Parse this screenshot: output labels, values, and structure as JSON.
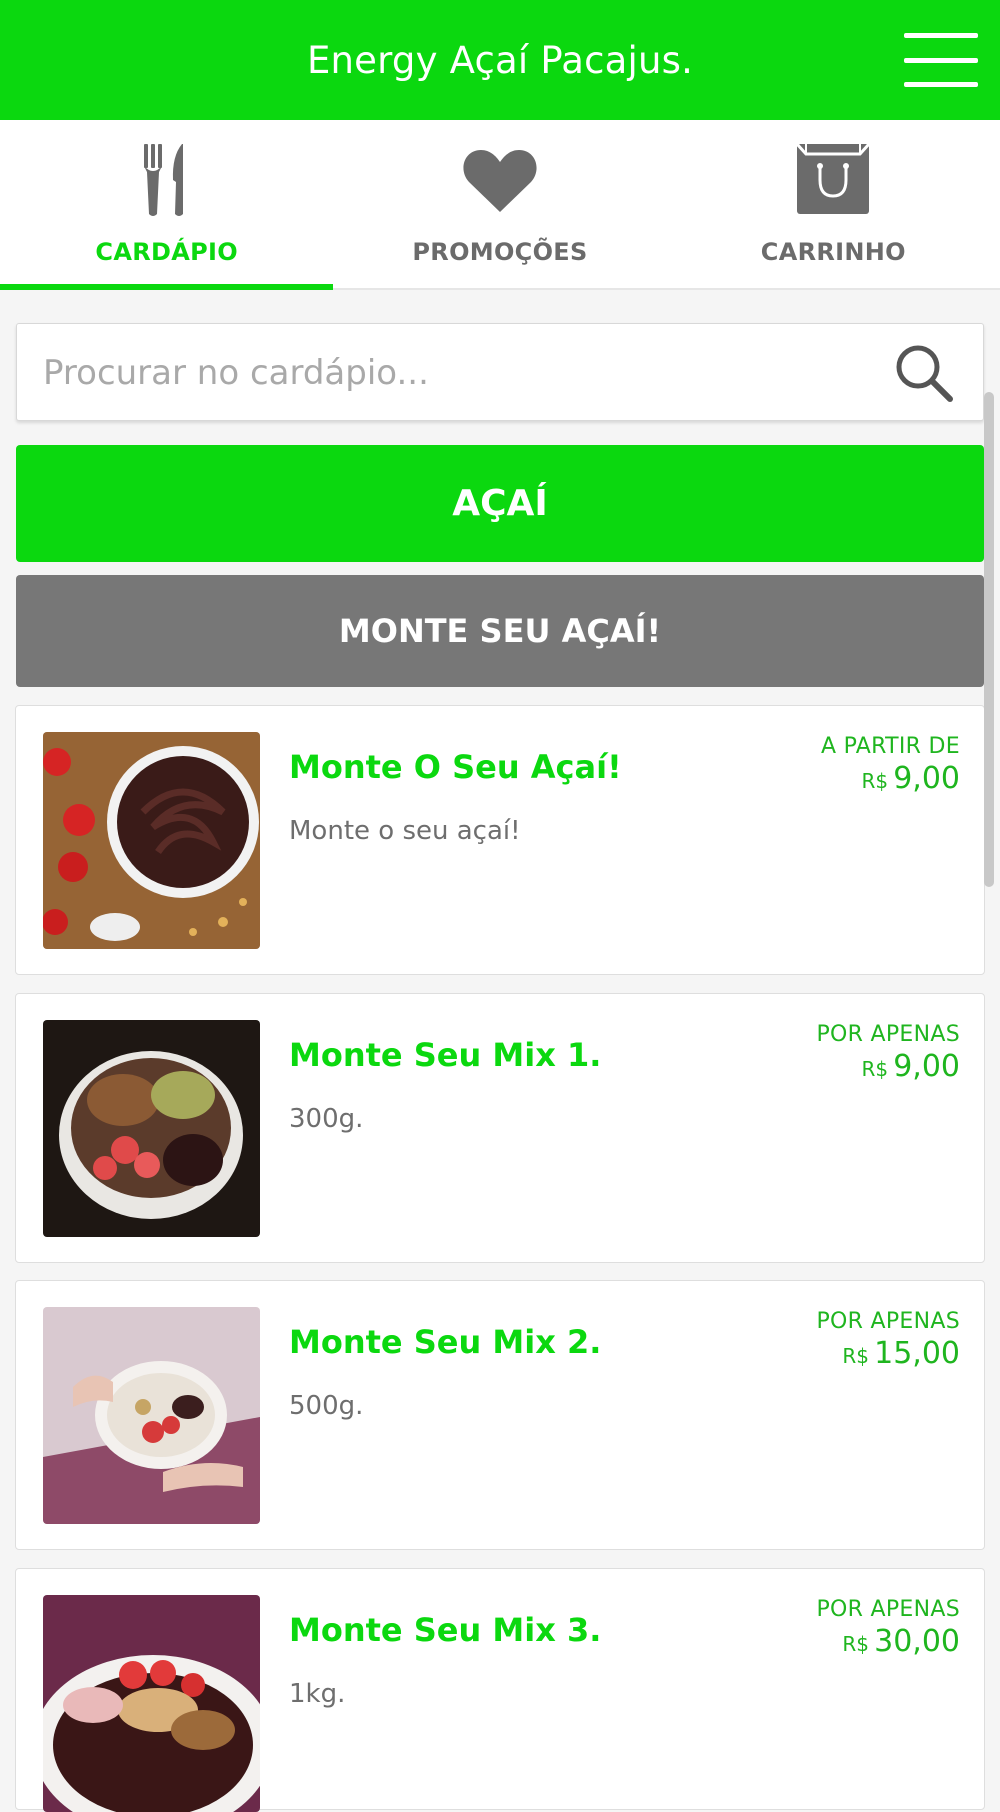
{
  "header": {
    "title": "Energy Açaí Pacajus.",
    "brand_color": "#0bd80f"
  },
  "tabs": [
    {
      "label": "CARDÁPIO",
      "icon": "fork-knife-icon",
      "active": true
    },
    {
      "label": "PROMOÇÕES",
      "icon": "heart-icon",
      "active": false
    },
    {
      "label": "CARRINHO",
      "icon": "shopping-bag-icon",
      "active": false
    }
  ],
  "search": {
    "placeholder": "Procurar no cardápio...",
    "value": "",
    "icon": "search-icon"
  },
  "categories": {
    "acai": "AÇAÍ",
    "monte": "MONTE SEU AÇAÍ!"
  },
  "products": [
    {
      "name": "Monte O Seu Açaí!",
      "description": "Monte o seu açaí!",
      "price_label": "A PARTIR DE",
      "currency": "R$",
      "price": "9,00"
    },
    {
      "name": "Monte Seu Mix 1.",
      "description": "300g.",
      "price_label": "POR APENAS",
      "currency": "R$",
      "price": "9,00"
    },
    {
      "name": "Monte Seu Mix 2.",
      "description": "500g.",
      "price_label": "POR APENAS",
      "currency": "R$",
      "price": "15,00"
    },
    {
      "name": "Monte Seu Mix 3.",
      "description": "1kg.",
      "price_label": "POR APENAS",
      "currency": "R$",
      "price": "30,00"
    }
  ]
}
